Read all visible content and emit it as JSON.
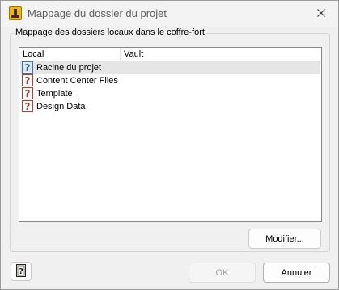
{
  "window": {
    "title": "Mappage du dossier du projet",
    "close_icon": "close-icon",
    "app_icon": "autodesk-vault-icon"
  },
  "group": {
    "title": "Mappage des dossiers locaux dans le coffre-fort"
  },
  "list": {
    "columns": [
      "Local",
      "Vault"
    ],
    "rows": [
      {
        "label": "Racine du projet",
        "vault": "",
        "icon": "question-blue-icon",
        "selected": true
      },
      {
        "label": "Content Center Files",
        "vault": "",
        "icon": "question-red-icon",
        "selected": false
      },
      {
        "label": "Template",
        "vault": "",
        "icon": "question-red-icon",
        "selected": false
      },
      {
        "label": "Design Data",
        "vault": "",
        "icon": "question-red-icon",
        "selected": false
      }
    ]
  },
  "buttons": {
    "modify_label": "Modifier...",
    "ok_label": "OK",
    "cancel_label": "Annuler",
    "help_icon": "help-book-icon"
  },
  "colors": {
    "selected_row": "#e5e5e5",
    "question_blue": "#3a6fb0",
    "question_red": "#c0392b",
    "app_icon_yellow": "#f2b705"
  }
}
